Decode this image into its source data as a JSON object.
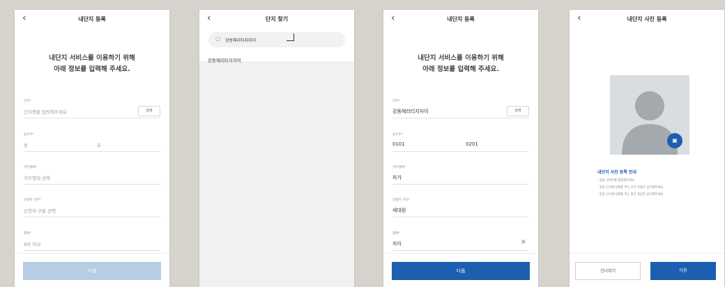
{
  "screens": [
    {
      "title": "내단지 등록",
      "intro": [
        "내단지 서비스를 이용하기 위해",
        "아래 정보를 입력해 주세요."
      ],
      "fields": [
        {
          "label": "단지",
          "placeholder": "단지명을 입력해주세요",
          "button": "검색"
        },
        {
          "label": "동호수",
          "placeholder_dong": "동",
          "placeholder_ho": "호"
        },
        {
          "label": "거주형태",
          "placeholder": "거주형태 선택"
        },
        {
          "label": "신청자 구분",
          "placeholder": "신청자 구분 선택"
        },
        {
          "label": "별명",
          "placeholder": "8자 이내"
        }
      ],
      "next_button": "다음"
    },
    {
      "title": "단지 찾기",
      "search_value": "강동헤리티지자이",
      "result": "강동헤리티지자이"
    },
    {
      "title": "내단지 등록",
      "intro": [
        "내단지 서비스를 이용하기 위해",
        "아래 정보를 입력해 주세요."
      ],
      "fields": [
        {
          "label": "단지",
          "value": "강동헤리티지자이",
          "button": "검색"
        },
        {
          "label": "동호수",
          "value_dong": "0101",
          "value_ho": "0201"
        },
        {
          "label": "거주형태",
          "value": "자가"
        },
        {
          "label": "신청자 구분",
          "value": "세대원"
        },
        {
          "label": "별명",
          "value": "자이",
          "clear": "×"
        }
      ],
      "next_button": "다음"
    },
    {
      "title": "내단지 사진 등록",
      "guide_title": "내단지 사진 등록 안내",
      "notes": [
        "· 얼굴 전면부를 촬영해주세요.",
        "· 얼굴 인식에 방해를 주는 모자 착용은 삼가해주세요.",
        "· 얼굴 인식에 방해를 주는 짙은 화장은 삼가해주세요."
      ],
      "skip_button": "건너뛰기",
      "next_button": "다음"
    }
  ],
  "colors": {
    "primary": "#1c5fb0",
    "disabled": "#b7cde4",
    "required": "#e0554e",
    "background": "#d6d3cd"
  }
}
